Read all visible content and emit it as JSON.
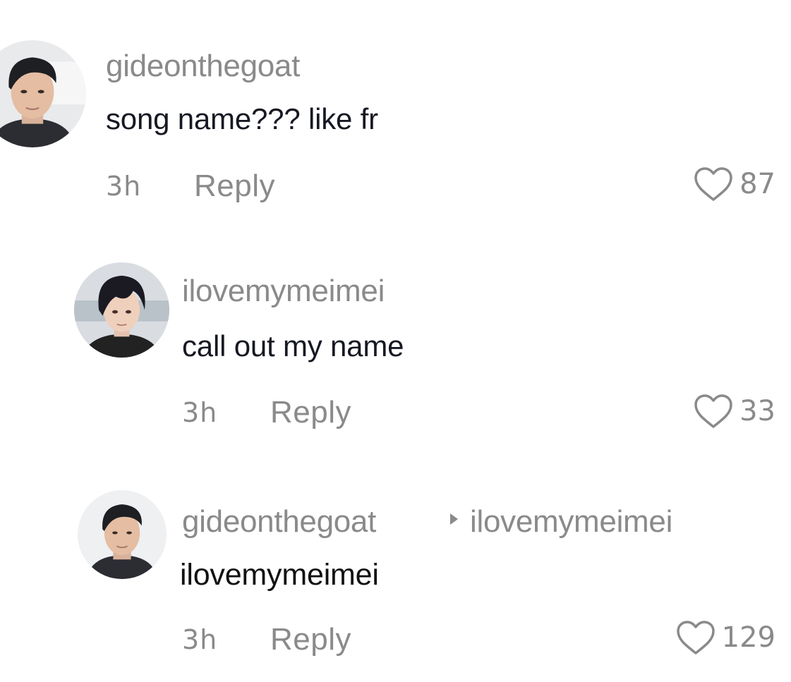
{
  "comments": [
    {
      "username": "gideonthegoat",
      "text": "song name??? like fr",
      "time": "3h",
      "reply_label": "Reply",
      "likes": "87",
      "avatar_icon": "avatar-dark-haired-man"
    },
    {
      "username": "ilovemymeimei",
      "text": "call out my name",
      "time": "3h",
      "reply_label": "Reply",
      "likes": "33",
      "avatar_icon": "avatar-dark-haired-man-anime"
    },
    {
      "username": "gideonthegoat",
      "reply_to": "ilovemymeimei",
      "text": "ilovemymeimei",
      "time": "3h",
      "reply_label": "Reply",
      "likes": "129",
      "avatar_icon": "avatar-dark-haired-man"
    }
  ],
  "colors": {
    "secondary_text": "#8a8a8a",
    "primary_text": "#161823",
    "background": "#ffffff"
  },
  "icons": {
    "like": "heart-outline-icon",
    "reply_to": "play-triangle-icon"
  }
}
